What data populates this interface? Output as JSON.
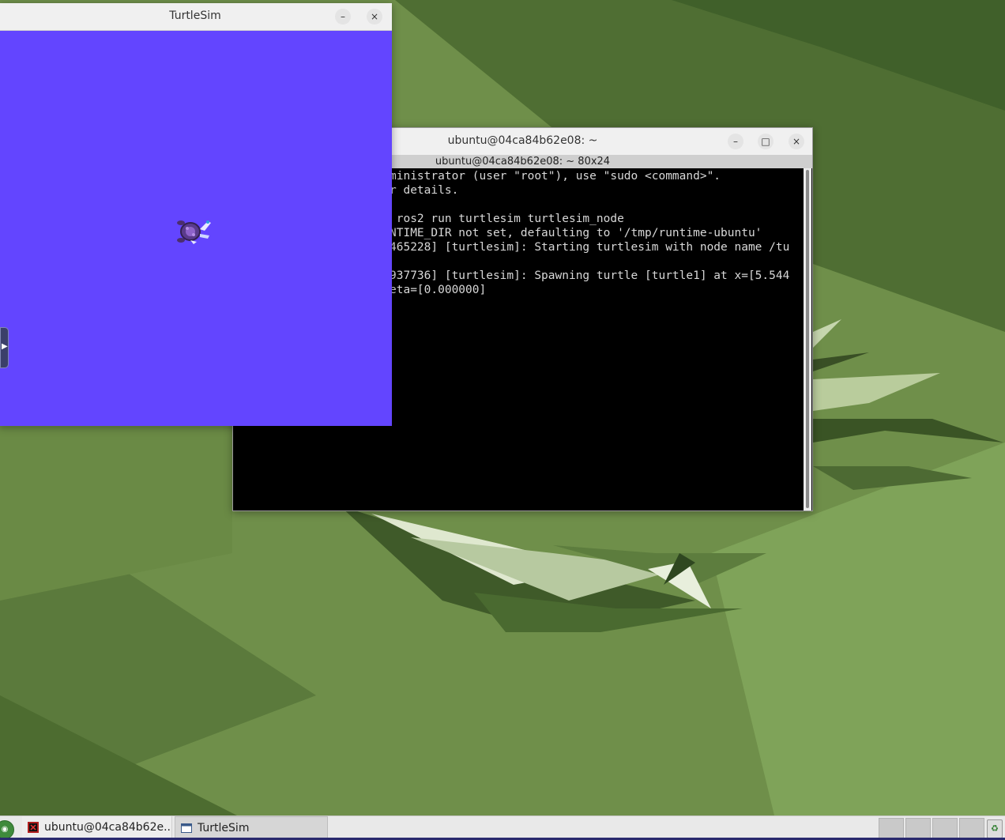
{
  "turtlesim_window": {
    "title": "TurtleSim",
    "minimize_symbol": "–",
    "close_symbol": "×",
    "background_color": "#6345ff"
  },
  "terminal_window": {
    "title": "ubuntu@04ca84b62e08: ~",
    "subtitle": "ubuntu@04ca84b62e08: ~ 80x24",
    "minimize_symbol": "–",
    "maximize_symbol": "□",
    "close_symbol": "×",
    "lines": [
      "ministrator (user \"root\"), use \"sudo <command>\".",
      "r details.",
      "",
      " ros2 run turtlesim turtlesim_node",
      "NTIME_DIR not set, defaulting to '/tmp/runtime-ubuntu'",
      "465228] [turtlesim]: Starting turtlesim with node name /tu",
      "",
      "937736] [turtlesim]: Spawning turtle [turtle1] at x=[5.544",
      "eta=[0.000000]"
    ]
  },
  "taskbar": {
    "items": [
      {
        "label": "ubuntu@04ca84b62e...",
        "icon": "terminal-icon"
      },
      {
        "label": "TurtleSim",
        "icon": "window-icon"
      }
    ]
  },
  "colors": {
    "wallpaper": "#6f8f4a",
    "terminal_bg": "#000000",
    "terminal_fg": "#d8d8d8"
  }
}
